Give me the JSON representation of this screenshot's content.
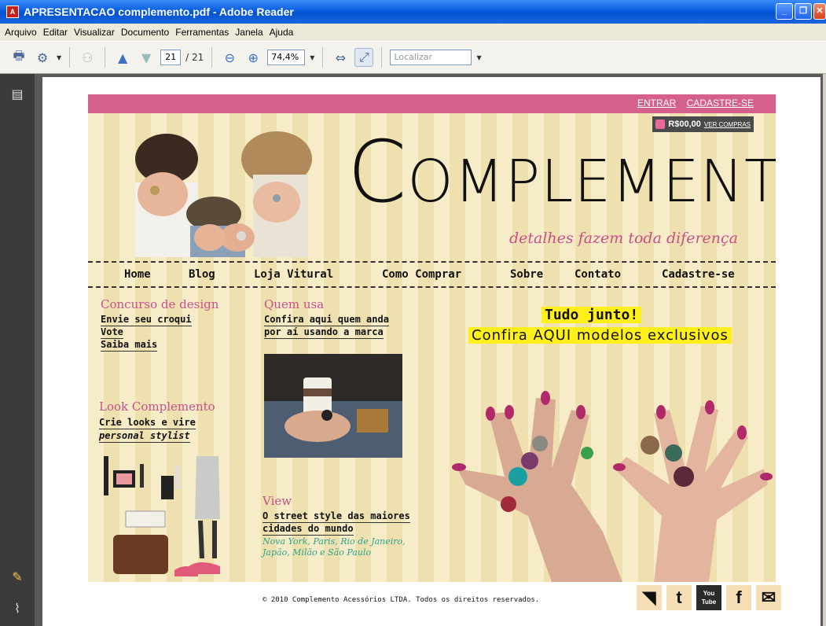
{
  "window": {
    "title": "APRESENTACAO complemento.pdf - Adobe Reader",
    "app_icon": "pdf-icon"
  },
  "menu": [
    "Arquivo",
    "Editar",
    "Visualizar",
    "Documento",
    "Ferramentas",
    "Janela",
    "Ajuda"
  ],
  "toolbar": {
    "page_current": "21",
    "page_total": "/ 21",
    "zoom": "74,4%",
    "search_placeholder": "Localizar"
  },
  "site": {
    "top_links": [
      "ENTRAR",
      "CADASTRE-SE"
    ],
    "cart_total": "R$00,00",
    "cart_link": "VER COMPRAS",
    "logo": {
      "first": "C",
      "rest": "OMPLEMENTO"
    },
    "tagline": "detalhes fazem toda diferença",
    "nav": [
      "Home",
      "Blog",
      "Loja Vitural",
      "Como Comprar",
      "Sobre",
      "Contato",
      "Cadastre-se"
    ],
    "concurso": {
      "title": "Concurso de design",
      "links": [
        "Envie seu croqui",
        "Vote",
        "Saiba mais"
      ]
    },
    "look": {
      "title": "Look Complemento",
      "line1": "Crie looks e vire",
      "line2": "personal stylist"
    },
    "quem_usa": {
      "title": "Quem usa",
      "line1": "Confira aqui quem anda",
      "line2": "por aí usando a marca"
    },
    "view": {
      "title": "View",
      "line1": "O street style das maiores",
      "line2": "cidades do mundo",
      "sub1": "Nova York, Paris, Rio de Janeiro,",
      "sub2": "Japão, Milão e São Paulo"
    },
    "promo": {
      "line1": "Tudo junto!",
      "line2": "Confira AQUI modelos exclusivos"
    },
    "footer": "© 2010 Complemento Acessórios LTDA. Todos os direitos reservados.",
    "social": [
      "rss-icon",
      "twitter-icon",
      "youtube-icon",
      "facebook-icon",
      "email-icon"
    ],
    "social_labels": {
      "youtube": "You Tube"
    }
  }
}
